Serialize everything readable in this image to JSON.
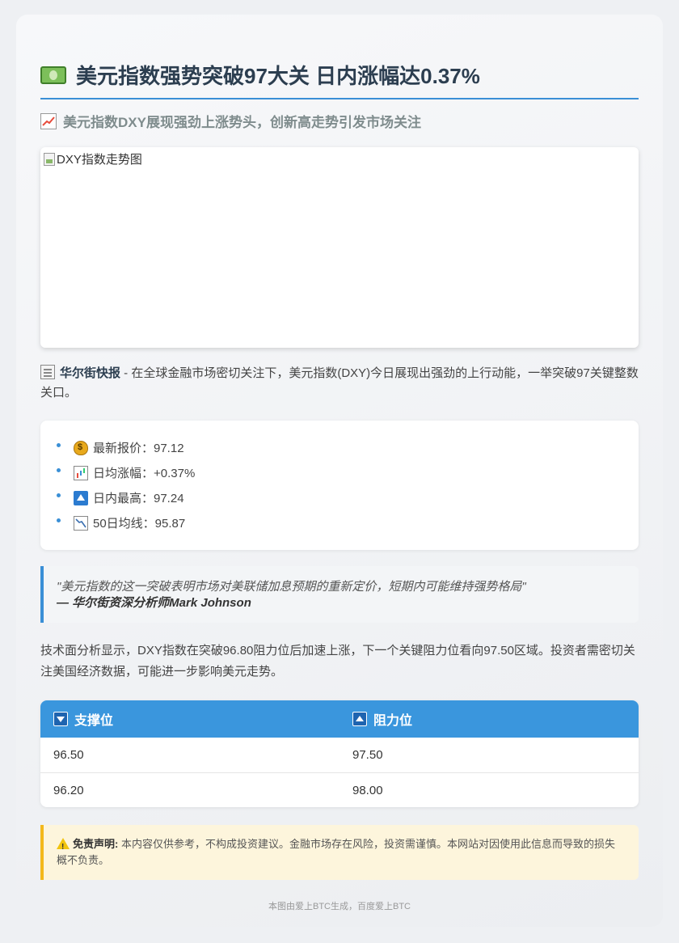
{
  "header": {
    "title": "美元指数强势突破97大关 日内涨幅达0.37%",
    "subtitle": "美元指数DXY展现强劲上涨势头，创新高走势引发市场关注"
  },
  "image": {
    "alt": "DXY指数走势图"
  },
  "intro": {
    "source": "华尔街快报",
    "text": " - 在全球金融市场密切关注下，美元指数(DXY)今日展现出强劲的上行动能，一举突破97关键整数关口。"
  },
  "stats": [
    {
      "icon": "money-bag-icon",
      "label": "最新报价：97.12"
    },
    {
      "icon": "bar-chart-icon",
      "label": "日均涨幅：+0.37%"
    },
    {
      "icon": "up-arrow-icon",
      "label": "日内最高：97.24"
    },
    {
      "icon": "down-trend-chart-icon",
      "label": "50日均线：95.87"
    }
  ],
  "quote": {
    "text": "\"美元指数的这一突破表明市场对美联储加息预期的重新定价，短期内可能维持强势格局\"",
    "author": "— 华尔街资深分析师Mark Johnson"
  },
  "analysis": "技术面分析显示，DXY指数在突破96.80阻力位后加速上涨，下一个关键阻力位看向97.50区域。投资者需密切关注美国经济数据，可能进一步影响美元走势。",
  "levels": {
    "support_header": "支撑位",
    "resistance_header": "阻力位",
    "rows": [
      {
        "support": "96.50",
        "resistance": "97.50"
      },
      {
        "support": "96.20",
        "resistance": "98.00"
      }
    ]
  },
  "disclaimer": {
    "label": "免责声明:",
    "text": " 本内容仅供参考，不构成投资建议。金融市场存在风险，投资需谨慎。本网站对因使用此信息而导致的损失概不负责。"
  },
  "footer": "本图由爱上BTC生成，百度爱上BTC",
  "colors": {
    "accent": "#3a8fd6",
    "table_header": "#3a96dd",
    "warning": "#f3b81b"
  }
}
